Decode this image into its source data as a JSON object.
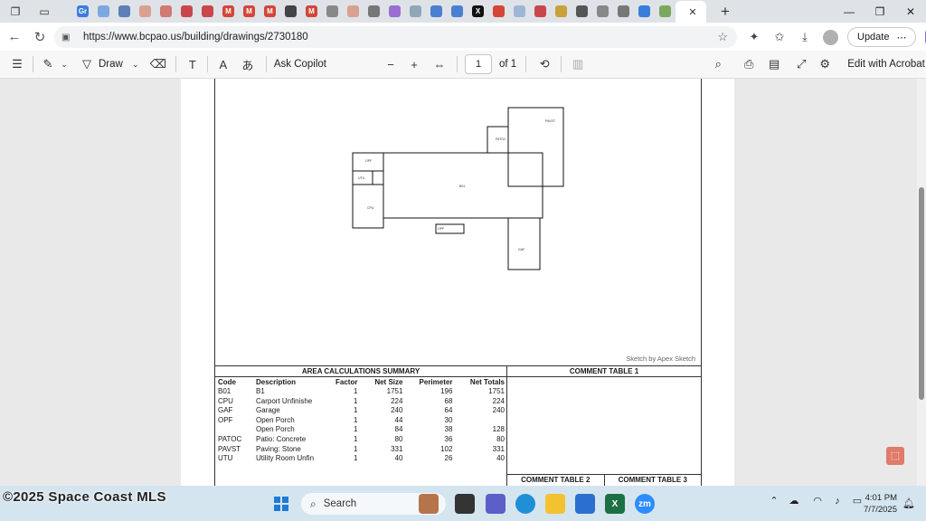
{
  "browser": {
    "tabs": [
      {
        "icon": "gr-icon",
        "color": "#3b7ddd",
        "glyph": "Gr"
      },
      {
        "icon": "document-icon",
        "color": "#7da7e0",
        "glyph": ""
      },
      {
        "icon": "globe-icon",
        "color": "#5c7fb8",
        "glyph": ""
      },
      {
        "icon": "page-icon",
        "color": "#d9a192",
        "glyph": ""
      },
      {
        "icon": "pdf-icon",
        "color": "#d27a74",
        "glyph": ""
      },
      {
        "icon": "house-icon",
        "color": "#c9474b",
        "glyph": ""
      },
      {
        "icon": "house-icon",
        "color": "#c9474b",
        "glyph": ""
      },
      {
        "icon": "gmail-icon",
        "color": "#d44638",
        "glyph": "M"
      },
      {
        "icon": "gmail-icon",
        "color": "#d44638",
        "glyph": "M"
      },
      {
        "icon": "gmail-icon",
        "color": "#d44638",
        "glyph": "M"
      },
      {
        "icon": "globe-icon",
        "color": "#444444",
        "glyph": ""
      },
      {
        "icon": "gmail-icon",
        "color": "#d44638",
        "glyph": "M"
      },
      {
        "icon": "globe-icon",
        "color": "#888888",
        "glyph": ""
      },
      {
        "icon": "page-icon",
        "color": "#d9a192",
        "glyph": ""
      },
      {
        "icon": "circle-icon",
        "color": "#777777",
        "glyph": ""
      },
      {
        "icon": "grid-icon",
        "color": "#9b6fd1",
        "glyph": ""
      },
      {
        "icon": "map-icon",
        "color": "#8fa7b8",
        "glyph": ""
      },
      {
        "icon": "target-icon",
        "color": "#4a7fd1",
        "glyph": ""
      },
      {
        "icon": "target-icon",
        "color": "#4a7fd1",
        "glyph": ""
      },
      {
        "icon": "x-icon",
        "color": "#111111",
        "glyph": "X"
      },
      {
        "icon": "no-icon",
        "color": "#d44638",
        "glyph": ""
      },
      {
        "icon": "document-icon",
        "color": "#9fb6d8",
        "glyph": ""
      },
      {
        "icon": "puzzle-icon",
        "color": "#c9474b",
        "glyph": ""
      },
      {
        "icon": "arrow-icon",
        "color": "#c7a23a",
        "glyph": ""
      },
      {
        "icon": "swirl-icon",
        "color": "#555555",
        "glyph": ""
      },
      {
        "icon": "globe-icon",
        "color": "#888888",
        "glyph": ""
      },
      {
        "icon": "circle-icon",
        "color": "#777777",
        "glyph": ""
      },
      {
        "icon": "search-icon",
        "color": "#3b7ddd",
        "glyph": ""
      },
      {
        "icon": "image-icon",
        "color": "#7aa85e",
        "glyph": ""
      }
    ],
    "url": "https://www.bcpao.us/building/drawings/2730180",
    "update_label": "Update"
  },
  "pdf_toolbar": {
    "draw_label": "Draw",
    "ask_copilot_label": "Ask Copilot",
    "page_number": "1",
    "page_total": "of 1",
    "edit_acrobat_label": "Edit with Acrobat"
  },
  "sketch": {
    "credit": "Sketch by Apex Sketch"
  },
  "area_summary": {
    "title": "AREA CALCULATIONS SUMMARY",
    "columns": [
      "Code",
      "Description",
      "Factor",
      "Net Size",
      "Perimeter",
      "Net Totals"
    ],
    "rows": [
      [
        "B01",
        "B1",
        "1",
        "1751",
        "196",
        "1751"
      ],
      [
        "CPU",
        "Carport Unfinishe",
        "1",
        "224",
        "68",
        "224"
      ],
      [
        "GAF",
        "Garage",
        "1",
        "240",
        "64",
        "240"
      ],
      [
        "OPF",
        "Open Porch",
        "1",
        "44",
        "30",
        ""
      ],
      [
        "",
        "Open Porch",
        "1",
        "84",
        "38",
        "128"
      ],
      [
        "PATOC",
        "Patio: Concrete",
        "1",
        "80",
        "36",
        "80"
      ],
      [
        "PAVST",
        "Paving: Stone",
        "1",
        "331",
        "102",
        "331"
      ],
      [
        "UTU",
        "Utility Room Unfin",
        "1",
        "40",
        "26",
        "40"
      ]
    ]
  },
  "comments": {
    "table1": "COMMENT TABLE 1",
    "table2": "COMMENT TABLE 2",
    "table3": "COMMENT TABLE 3"
  },
  "taskbar": {
    "watermark": "©2025 Space Coast MLS",
    "search_label": "Search",
    "time": "4:01 PM",
    "date": "7/7/2025"
  }
}
